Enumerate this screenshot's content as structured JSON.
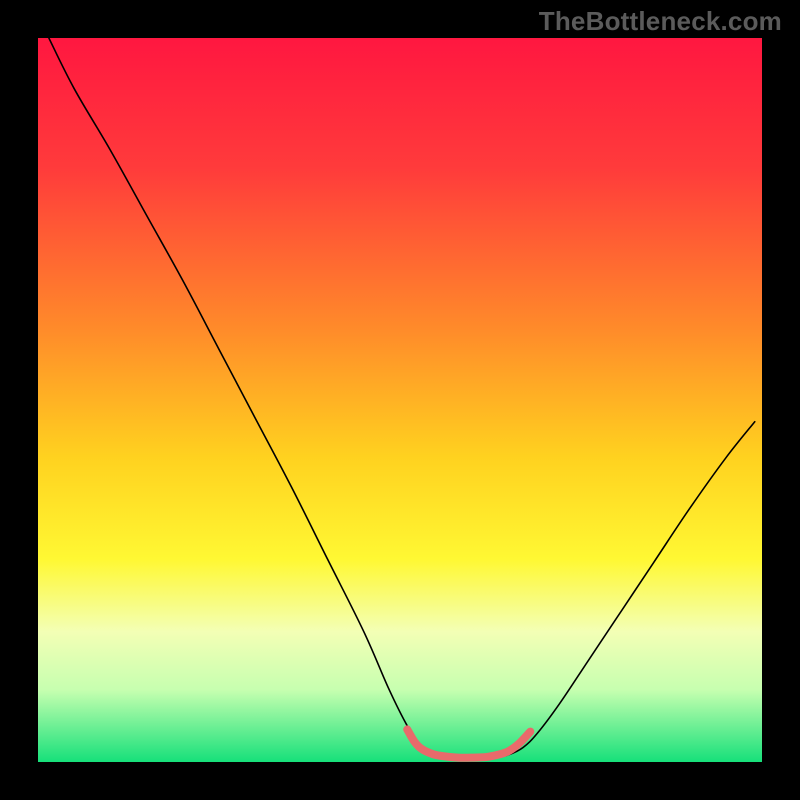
{
  "watermark": "TheBottleneck.com",
  "chart_data": {
    "type": "line",
    "title": "",
    "xlabel": "",
    "ylabel": "",
    "xlim": [
      0,
      100
    ],
    "ylim": [
      0,
      100
    ],
    "gradient_stops": [
      {
        "offset": 0,
        "color": "#ff1740"
      },
      {
        "offset": 18,
        "color": "#ff3b3b"
      },
      {
        "offset": 40,
        "color": "#ff8a2a"
      },
      {
        "offset": 58,
        "color": "#ffd21f"
      },
      {
        "offset": 72,
        "color": "#fff833"
      },
      {
        "offset": 82,
        "color": "#f3ffb5"
      },
      {
        "offset": 90,
        "color": "#c7ffb0"
      },
      {
        "offset": 100,
        "color": "#16e07a"
      }
    ],
    "series": [
      {
        "name": "bottleneck-curve",
        "stroke": "#000000",
        "stroke_width": 1.6,
        "points": [
          {
            "x": 1.5,
            "y": 100.0
          },
          {
            "x": 5,
            "y": 93.0
          },
          {
            "x": 10,
            "y": 84.5
          },
          {
            "x": 15,
            "y": 75.5
          },
          {
            "x": 20,
            "y": 66.5
          },
          {
            "x": 25,
            "y": 57.0
          },
          {
            "x": 30,
            "y": 47.5
          },
          {
            "x": 35,
            "y": 38.0
          },
          {
            "x": 40,
            "y": 28.0
          },
          {
            "x": 45,
            "y": 18.0
          },
          {
            "x": 48.5,
            "y": 10.0
          },
          {
            "x": 51,
            "y": 5.0
          },
          {
            "x": 53,
            "y": 2.0
          },
          {
            "x": 55,
            "y": 0.7
          },
          {
            "x": 58,
            "y": 0.5
          },
          {
            "x": 61,
            "y": 0.5
          },
          {
            "x": 63,
            "y": 0.6
          },
          {
            "x": 65,
            "y": 1.0
          },
          {
            "x": 67,
            "y": 2.0
          },
          {
            "x": 69,
            "y": 4.0
          },
          {
            "x": 72,
            "y": 8.0
          },
          {
            "x": 76,
            "y": 14.0
          },
          {
            "x": 80,
            "y": 20.0
          },
          {
            "x": 85,
            "y": 27.5
          },
          {
            "x": 90,
            "y": 35.0
          },
          {
            "x": 95,
            "y": 42.0
          },
          {
            "x": 99,
            "y": 47.0
          }
        ]
      },
      {
        "name": "bottom-marker",
        "stroke": "#e96a6b",
        "stroke_width": 8,
        "points": [
          {
            "x": 51,
            "y": 4.5
          },
          {
            "x": 52,
            "y": 2.8
          },
          {
            "x": 53,
            "y": 1.8
          },
          {
            "x": 54.5,
            "y": 1.1
          },
          {
            "x": 56,
            "y": 0.8
          },
          {
            "x": 58,
            "y": 0.6
          },
          {
            "x": 60,
            "y": 0.6
          },
          {
            "x": 62,
            "y": 0.7
          },
          {
            "x": 63.5,
            "y": 1.0
          },
          {
            "x": 65,
            "y": 1.5
          },
          {
            "x": 66.5,
            "y": 2.6
          },
          {
            "x": 68,
            "y": 4.2
          }
        ]
      }
    ]
  }
}
